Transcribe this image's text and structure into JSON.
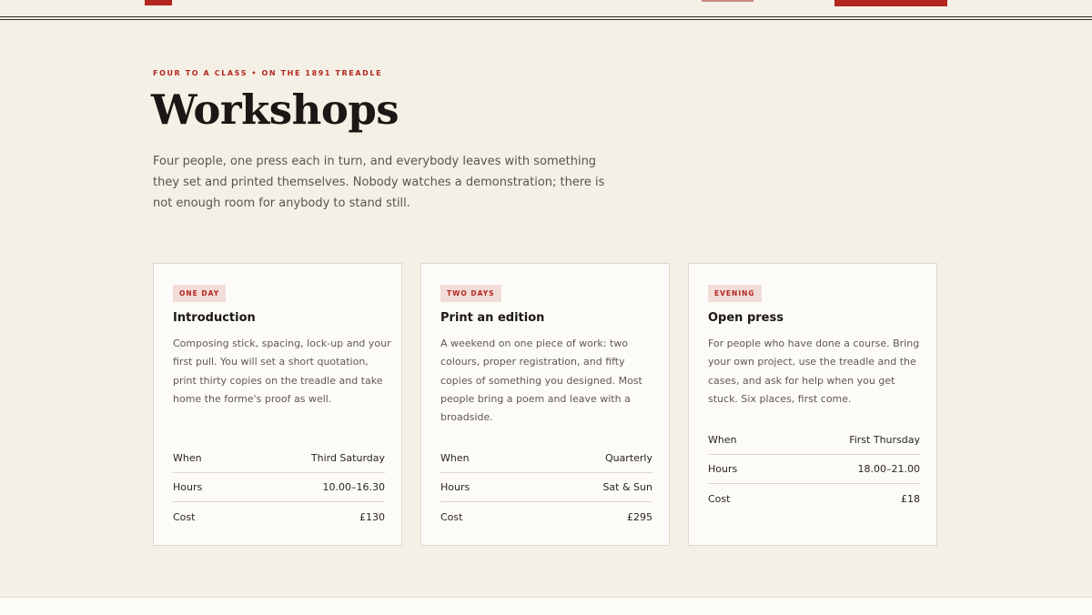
{
  "page": {
    "eyebrow": "FOUR TO A CLASS • ON THE 1891 TREADLE",
    "title": "Workshops",
    "intro": "Four people, one press each in turn, and everybody leaves with something they set and printed themselves. Nobody watches a demonstration; there is not enough room for anybody to stand still."
  },
  "colors": {
    "accent": "#b3261e",
    "background": "#f5f0e6",
    "card": "#fdfbf7",
    "badge_bg": "#f2dcd8"
  },
  "workshops": [
    {
      "badge": "ONE DAY",
      "title": "Introduction",
      "description": "Composing stick, spacing, lock-up and your first pull. You will set a short quotation, print thirty copies on the treadle and take home the forme's proof as well.",
      "details": [
        {
          "label": "When",
          "value": "Third Saturday"
        },
        {
          "label": "Hours",
          "value": "10.00–16.30"
        },
        {
          "label": "Cost",
          "value": "£130"
        }
      ]
    },
    {
      "badge": "TWO DAYS",
      "title": "Print an edition",
      "description": "A weekend on one piece of work: two colours, proper registration, and fifty copies of something you designed. Most people bring a poem and leave with a broadside.",
      "details": [
        {
          "label": "When",
          "value": "Quarterly"
        },
        {
          "label": "Hours",
          "value": "Sat & Sun"
        },
        {
          "label": "Cost",
          "value": "£295"
        }
      ]
    },
    {
      "badge": "EVENING",
      "title": "Open press",
      "description": "For people who have done a course. Bring your own project, use the treadle and the cases, and ask for help when you get stuck. Six places, first come.",
      "details": [
        {
          "label": "When",
          "value": "First Thursday"
        },
        {
          "label": "Hours",
          "value": "18.00–21.00"
        },
        {
          "label": "Cost",
          "value": "£18"
        }
      ]
    }
  ]
}
